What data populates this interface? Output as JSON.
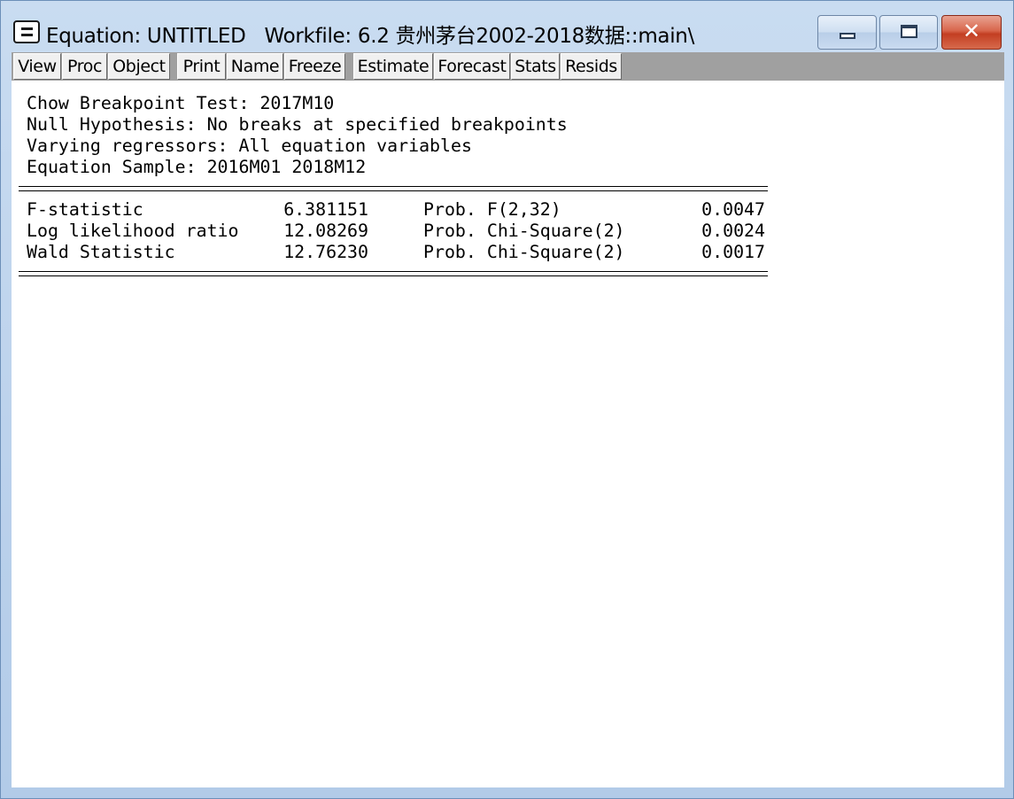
{
  "window": {
    "title": "Equation: UNTITLED   Workfile: 6.2 贵州茅台2002-2018数据::main\\",
    "minimize_icon": "minimize-icon",
    "maximize_icon": "maximize-icon",
    "close_icon": "close-icon",
    "close_glyph": "✕"
  },
  "toolbar": {
    "buttons": [
      "View",
      "Proc",
      "Object",
      "Print",
      "Name",
      "Freeze",
      "Estimate",
      "Forecast",
      "Stats",
      "Resids"
    ]
  },
  "output": {
    "header_lines": [
      "Chow Breakpoint Test: 2017M10",
      "Null Hypothesis: No breaks at specified breakpoints",
      "Varying regressors: All equation variables",
      "Equation Sample: 2016M01 2018M12"
    ],
    "rows": [
      {
        "label": "F-statistic",
        "value": "6.381151",
        "prob_label": "Prob. F(2,32)",
        "prob": "0.0047"
      },
      {
        "label": "Log likelihood ratio",
        "value": "12.08269",
        "prob_label": "Prob. Chi-Square(2)",
        "prob": "0.0024"
      },
      {
        "label": "Wald Statistic",
        "value": "12.76230",
        "prob_label": "Prob. Chi-Square(2)",
        "prob": "0.0017"
      }
    ]
  },
  "colors": {
    "frame": "#bcd2ec",
    "toolbar_bg": "#a0a0a0",
    "button_face": "#f0f0f0",
    "close_button": "#c33e22"
  }
}
